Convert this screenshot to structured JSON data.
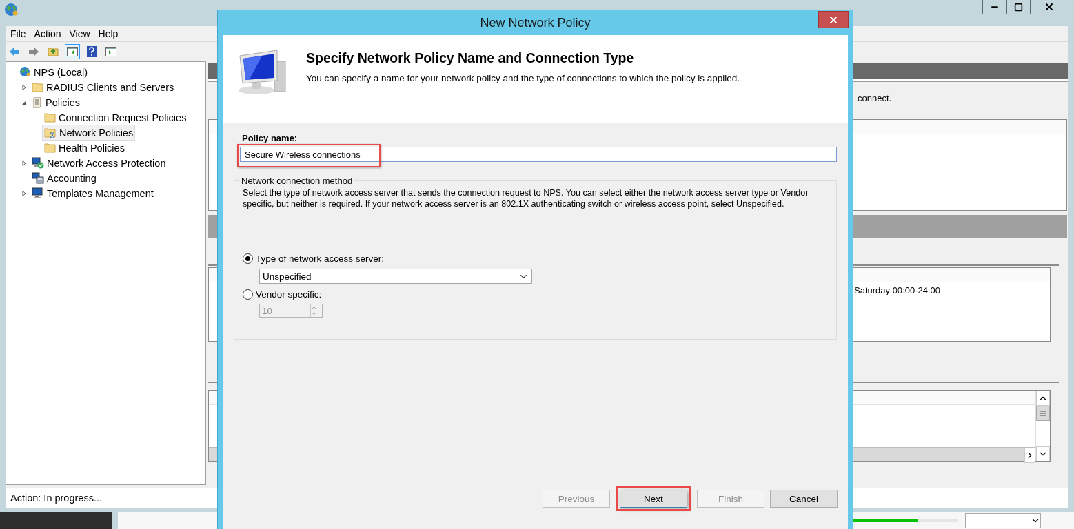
{
  "main_window": {
    "menu": [
      "File",
      "Action",
      "View",
      "Help"
    ],
    "tree": [
      {
        "label": "NPS (Local)",
        "kind": "globe",
        "selected": false,
        "children": [
          {
            "label": "RADIUS Clients and Servers",
            "kind": "folder",
            "expanded": false,
            "selected": false
          },
          {
            "label": "Policies",
            "kind": "scroll",
            "expanded": true,
            "selected": false,
            "children": [
              {
                "label": "Connection Request Policies",
                "kind": "folder",
                "selected": false
              },
              {
                "label": "Network Policies",
                "kind": "policy",
                "selected": true
              },
              {
                "label": "Health Policies",
                "kind": "folder",
                "selected": false
              }
            ]
          },
          {
            "label": "Network Access Protection",
            "kind": "nap",
            "expanded": false,
            "selected": false
          },
          {
            "label": "Accounting",
            "kind": "computers",
            "selected": false
          },
          {
            "label": "Templates Management",
            "kind": "computer",
            "expanded": false,
            "selected": false
          }
        ]
      }
    ],
    "description_tail": "connect.",
    "schedule_cell": "Saturday 00:00-24:00",
    "status": "Action:  In progress...",
    "background_progress": {
      "level": 0.72
    }
  },
  "dialog": {
    "title": "New Network Policy",
    "heading": "Specify Network Policy Name and Connection Type",
    "subtitle": "You can specify a name for your network policy and the type of connections to which the policy is applied.",
    "policy_name": {
      "label": "Policy name:",
      "value": "Secure Wireless connections",
      "highlighted": true
    },
    "method": {
      "legend": "Network connection method",
      "description": "Select the type of network access server that sends the connection request to NPS. You can select either the network access server type or Vendor specific, but neither is required.  If your network access server is an 802.1X authenticating switch or wireless access point, select Unspecified.",
      "options": [
        {
          "kind": "dropdown",
          "label": "Type of network access server:",
          "selected": true,
          "value": "Unspecified"
        },
        {
          "kind": "spinner",
          "label": "Vendor specific:",
          "selected": false,
          "value": "10"
        }
      ]
    },
    "buttons": [
      {
        "label": "Previous",
        "disabled": true,
        "highlighted": false
      },
      {
        "label": "Next",
        "disabled": false,
        "highlighted": true
      },
      {
        "label": "Finish",
        "disabled": true,
        "highlighted": false
      },
      {
        "label": "Cancel",
        "disabled": false,
        "highlighted": false
      }
    ]
  }
}
